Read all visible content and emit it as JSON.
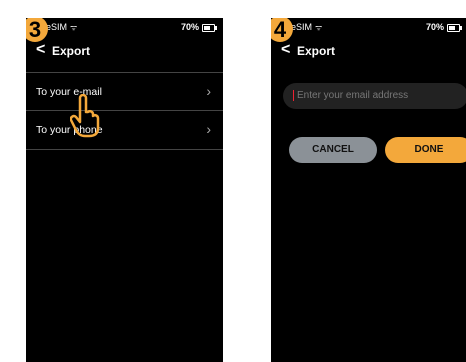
{
  "screen3": {
    "step": "3",
    "status": {
      "carrier": "eSIM",
      "battery": "70%"
    },
    "header": {
      "title": "Export"
    },
    "items": [
      {
        "label": "To your e-mail"
      },
      {
        "label": "To your phone"
      }
    ]
  },
  "screen4": {
    "step": "4",
    "status": {
      "carrier": "eSIM",
      "battery": "70%"
    },
    "header": {
      "title": "Export"
    },
    "email_input": {
      "placeholder": "Enter your email address"
    },
    "buttons": {
      "cancel": "CANCEL",
      "done": "DONE"
    }
  },
  "colors": {
    "accent": "#f3a83b",
    "background": "#000000",
    "cancel": "#8b9197"
  },
  "icons": {
    "back": "chevron-left-icon",
    "row": "chevron-right-icon",
    "tap": "hand-pointer-icon"
  }
}
